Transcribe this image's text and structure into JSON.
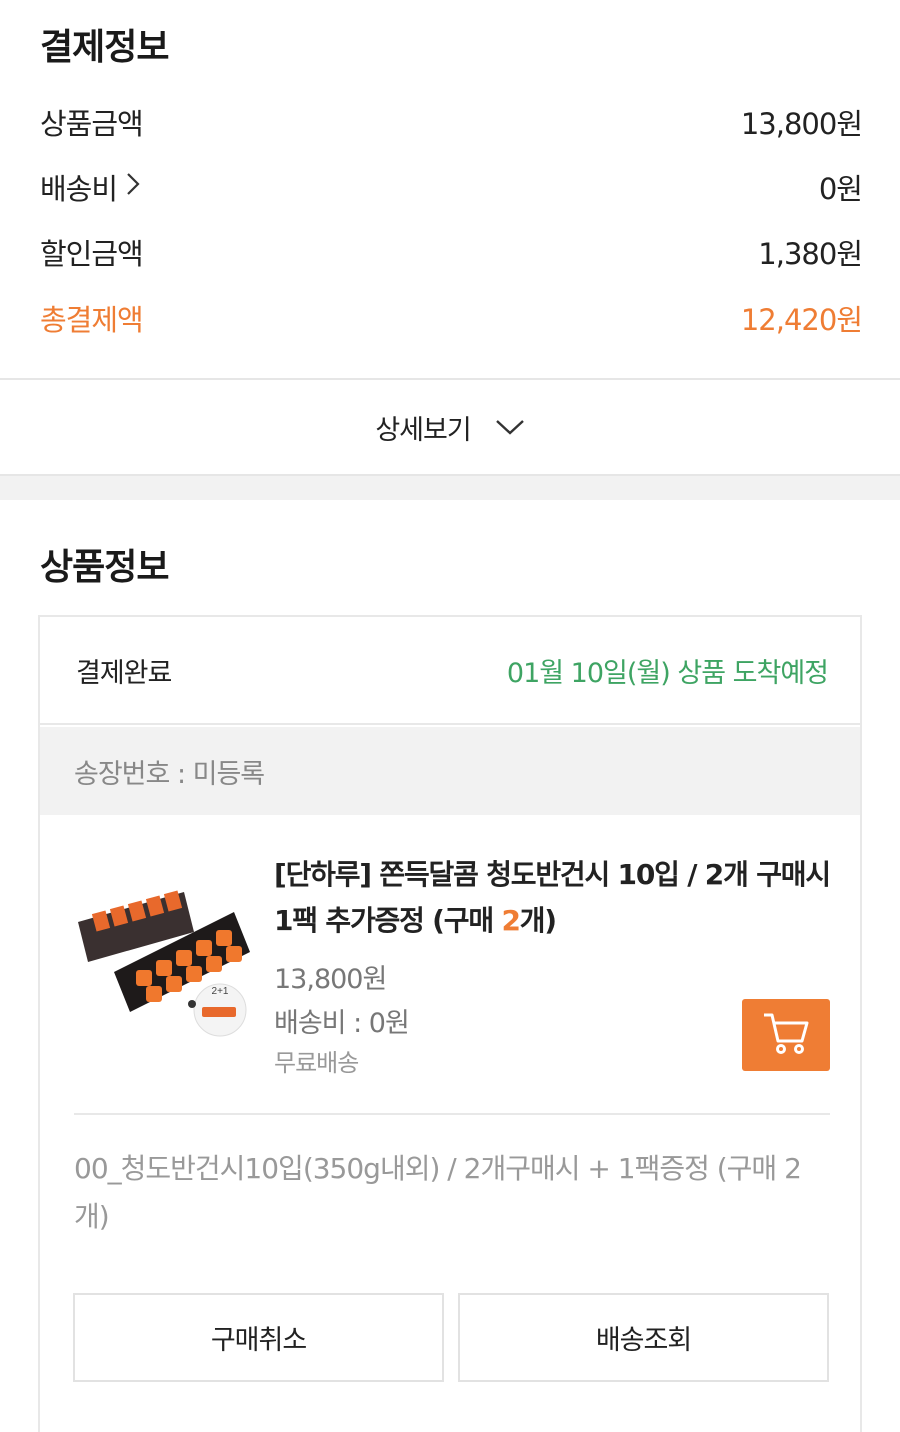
{
  "payment": {
    "title": "결제정보",
    "rows": [
      {
        "label": "상품금액",
        "value": "13,800원"
      },
      {
        "label": "배송비",
        "value": "0원"
      },
      {
        "label": "할인금액",
        "value": "1,380원"
      },
      {
        "label": "총결제액",
        "value": "12,420원"
      }
    ],
    "detail_toggle": "상세보기"
  },
  "product_section": {
    "title": "상품정보",
    "status": "결제완료",
    "arrival": "01월 10일(월) 상품 도착예정",
    "invoice": "송장번호 : 미등록",
    "item": {
      "title_main": "[단하루] 쫀득달콤 청도반건시 10입 / 2개 구매시 1팩 추가증정 (구매 ",
      "title_qty": "2",
      "title_suffix": "개)",
      "price": "13,800원",
      "shipping": "배송비 : 0원",
      "free_shipping": "무료배송",
      "option": "00_청도반건시10입(350g내외) / 2개구매시 + 1팩증정 (구매 2개)",
      "thumb_badge": "2+1"
    },
    "buttons": {
      "cancel": "구매취소",
      "track": "배송조회"
    }
  },
  "colors": {
    "accent": "#ef7d34",
    "arrival_green": "#3ea463",
    "divider": "#e8e8e8",
    "band": "#f2f2f2"
  },
  "icons": [
    "chevron-right-icon",
    "chevron-down-icon",
    "cart-icon"
  ]
}
